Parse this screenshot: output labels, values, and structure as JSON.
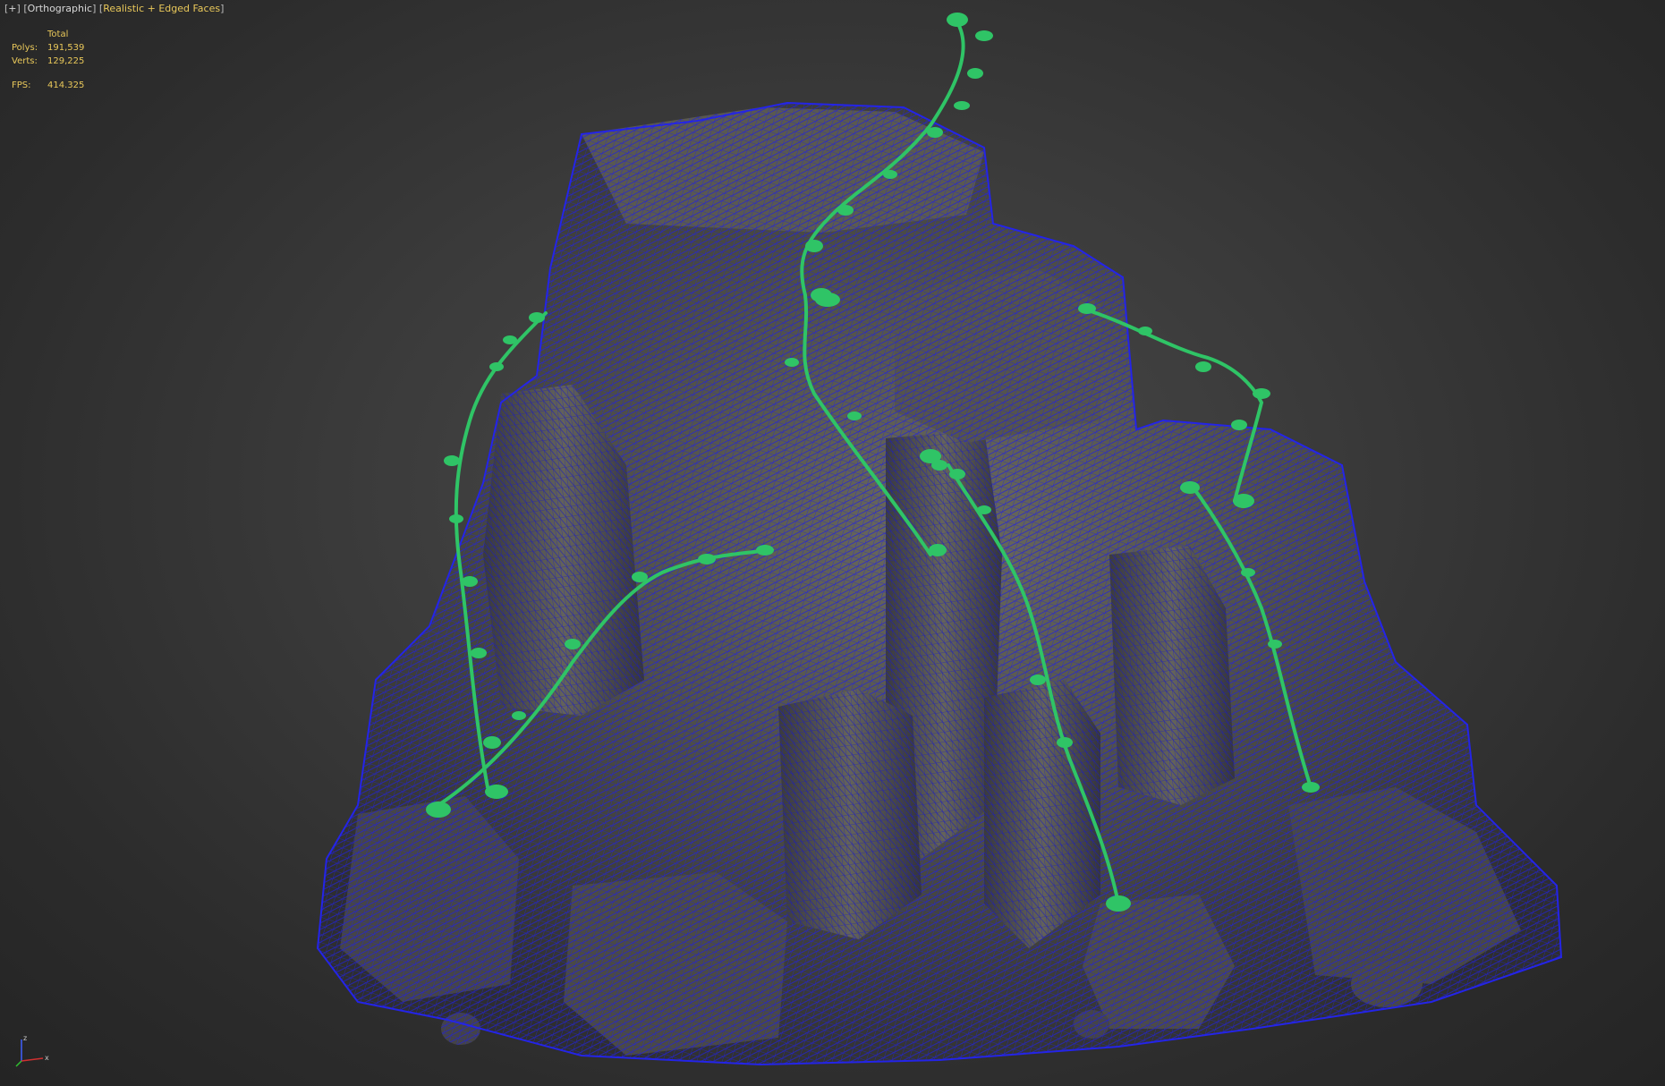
{
  "viewport_menu": {
    "plus": "+",
    "view": "Orthographic",
    "shading": "Realistic + Edged Faces"
  },
  "stats": {
    "header": "Total",
    "polys_label": "Polys:",
    "polys_value": "191,539",
    "verts_label": "Verts:",
    "verts_value": "129,225",
    "fps_label": "FPS:",
    "fps_value": "414.325"
  },
  "gizmo": {
    "axis_z": "z",
    "axis_x": "x",
    "color_x": "#d03030",
    "color_y": "#30c030",
    "color_z": "#4060ff"
  },
  "colors": {
    "wireframe": "#1a1ad8",
    "rock": "#4a4a44",
    "vine": "#2fc466",
    "background": "#3a3a3a"
  }
}
